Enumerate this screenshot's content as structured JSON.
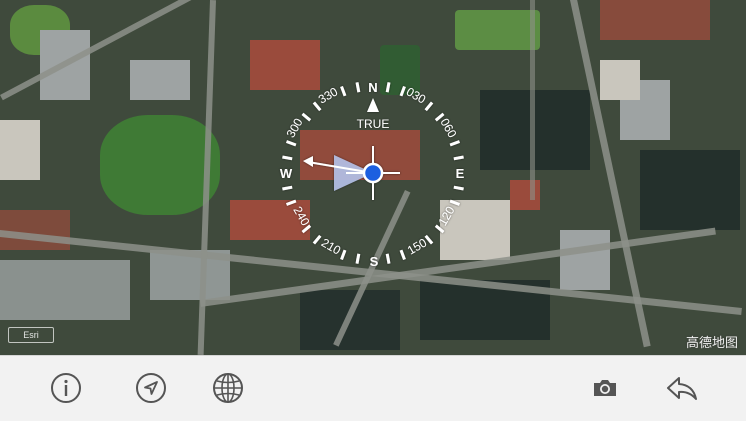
{
  "map": {
    "watermark": "高德地图",
    "logo_text": "Esri"
  },
  "compass": {
    "mode_label": "TRUE",
    "cardinals": {
      "north": "N",
      "east": "E",
      "south": "S",
      "west": "W"
    },
    "degree_labels": [
      "030",
      "060",
      "120",
      "150",
      "210",
      "240",
      "300",
      "330"
    ],
    "heading_deg": 280,
    "colors": {
      "ring": "#ffffff",
      "north_marker": "#ffffff",
      "center_dot": "#1f5fe0",
      "heading_cone": "#b9c7ef"
    }
  },
  "toolbar": {
    "buttons": [
      {
        "icon": "info-icon"
      },
      {
        "icon": "location-arrow-icon"
      },
      {
        "icon": "globe-icon"
      },
      {
        "icon": "camera-icon"
      },
      {
        "icon": "back-arrow-icon"
      }
    ],
    "icon_color": "#555555"
  }
}
